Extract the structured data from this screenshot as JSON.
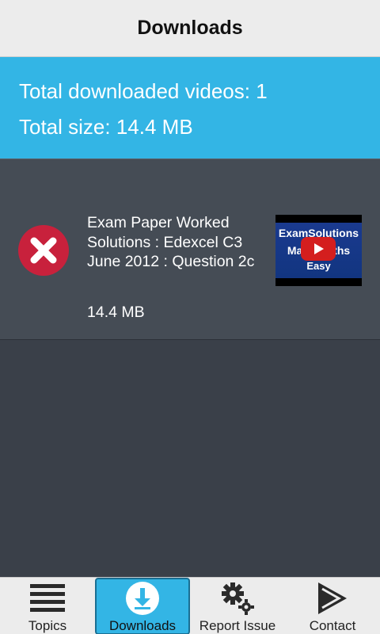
{
  "header": {
    "title": "Downloads"
  },
  "summary": {
    "total_videos": "Total downloaded videos: 1",
    "total_size": "Total size: 14.4 MB"
  },
  "downloads": [
    {
      "title": "Exam Paper Worked Solutions : Edexcel C3 June 2012 : Question 2c",
      "size": "14.4 MB",
      "thumbnail": {
        "line1": "ExamSolutions",
        "line2": "Make Maths",
        "line3": "Easy"
      },
      "delete_icon": "delete-circle-icon"
    }
  ],
  "tabs": [
    {
      "label": "Topics",
      "icon": "menu-lines-icon",
      "active": false
    },
    {
      "label": "Downloads",
      "icon": "download-icon",
      "active": true
    },
    {
      "label": "Report Issue",
      "icon": "gears-icon",
      "active": false
    },
    {
      "label": "Contact",
      "icon": "send-arrow-icon",
      "active": false
    }
  ],
  "colors": {
    "accent": "#33b5e5",
    "delete": "#c8213c",
    "background": "#3a4049",
    "row": "#454c55"
  }
}
